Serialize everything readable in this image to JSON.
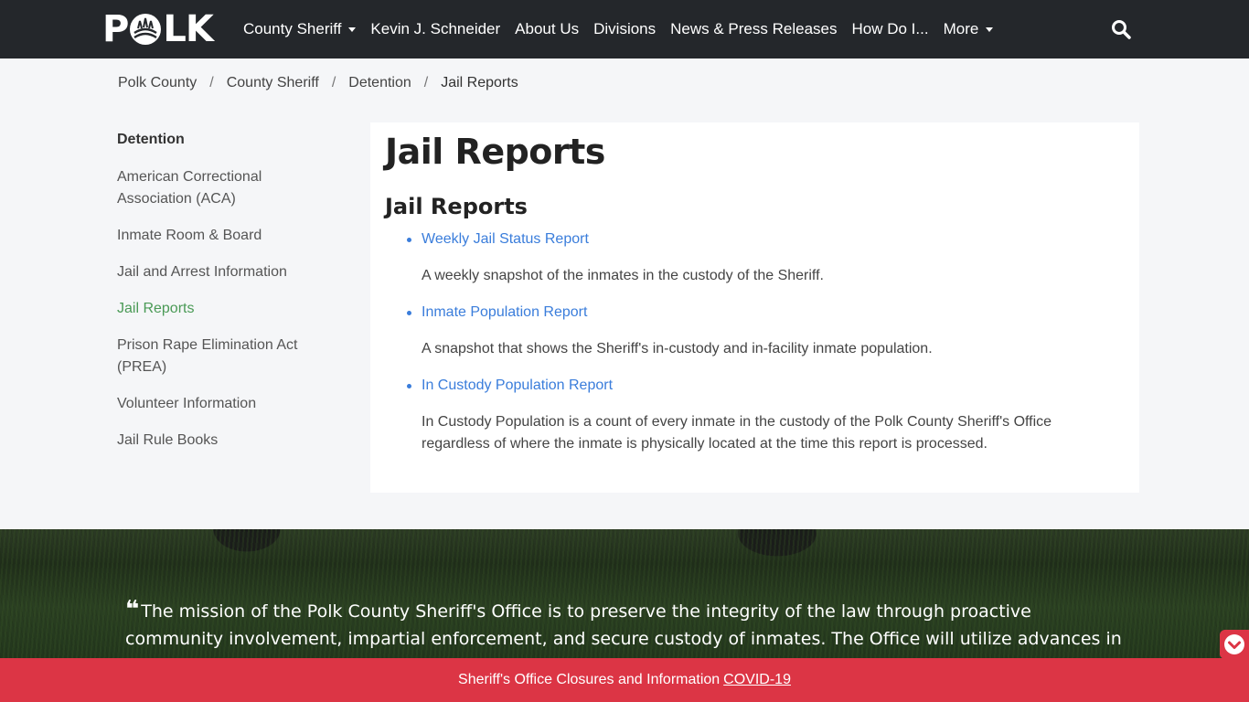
{
  "navbar": {
    "logo_left": "P",
    "logo_right": "LK",
    "items": [
      {
        "label": "County Sheriff",
        "dropdown": true
      },
      {
        "label": "Kevin J. Schneider",
        "dropdown": false
      },
      {
        "label": "About Us",
        "dropdown": false
      },
      {
        "label": "Divisions",
        "dropdown": false
      },
      {
        "label": "News & Press Releases",
        "dropdown": false
      },
      {
        "label": "How Do I...",
        "dropdown": false
      },
      {
        "label": "More",
        "dropdown": true
      }
    ],
    "search_icon": "search-icon"
  },
  "breadcrumb": [
    "Polk County",
    "County Sheriff",
    "Detention",
    "Jail Reports"
  ],
  "sidebar": {
    "heading": "Detention",
    "items": [
      {
        "label": "American Correctional Association (ACA)",
        "active": false
      },
      {
        "label": "Inmate Room & Board",
        "active": false
      },
      {
        "label": "Jail and Arrest Information",
        "active": false
      },
      {
        "label": "Jail Reports",
        "active": true
      },
      {
        "label": "Prison Rape Elimination Act (PREA)",
        "active": false
      },
      {
        "label": "Volunteer Information",
        "active": false
      },
      {
        "label": "Jail Rule Books",
        "active": false
      }
    ]
  },
  "content": {
    "title": "Jail Reports",
    "section_title": "Jail Reports",
    "reports": [
      {
        "link": "Weekly Jail Status Report",
        "description": "A weekly snapshot of the inmates in the custody of the Sheriff."
      },
      {
        "link": "Inmate Population Report",
        "description": "A snapshot that shows the Sheriff's in-custody and in-facility inmate population."
      },
      {
        "link": "In Custody Population Report",
        "description": "In Custody Population is a count of every inmate in the custody of the Polk County Sheriff's Office regardless of where the inmate is physically located at the time this report is processed."
      }
    ]
  },
  "mission": {
    "text": "The mission of the Polk County Sheriff's Office is to preserve the integrity of the law through proactive community involvement, impartial enforcement, and secure custody of inmates. The Office will utilize advances in technology to"
  },
  "alert": {
    "text": "Sheriff's Office Closures and Information",
    "link": "COVID-19"
  },
  "colors": {
    "navbar": "#24272b",
    "link": "#3a7ddb",
    "active": "#4a9a56",
    "alert": "#dc3545"
  }
}
